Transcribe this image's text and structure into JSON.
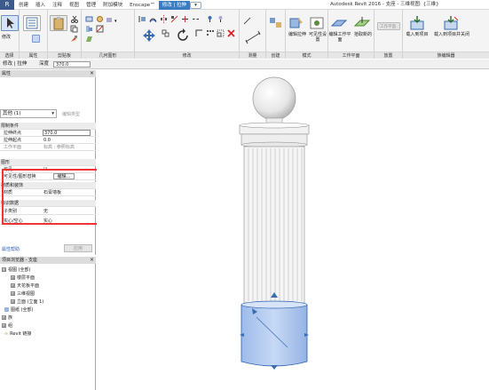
{
  "titlebar": {
    "app_button": "R",
    "tabs": [
      "创建",
      "插入",
      "注释",
      "视图",
      "管理",
      "附加模块",
      "Enscape™",
      "修改 | 拉伸"
    ],
    "title": "Autodesk Revit 2016 -     支座 - 三维视图: {三维}"
  },
  "ribbon": {
    "panels": [
      {
        "label": "选择",
        "buttons": [
          "修改"
        ]
      },
      {
        "label": "属性",
        "buttons": []
      },
      {
        "label": "剪贴板",
        "buttons": []
      },
      {
        "label": "几何图形",
        "buttons": []
      },
      {
        "label": "修改",
        "buttons": []
      },
      {
        "label": "测量",
        "buttons": []
      },
      {
        "label": "创建",
        "buttons": []
      },
      {
        "label": "模式",
        "buttons": [
          "编辑拉伸",
          "可见性设置"
        ]
      },
      {
        "label": "工作平面",
        "buttons": [
          "编辑工作平面",
          "拾取新的"
        ]
      },
      {
        "label": "放置",
        "buttons": [
          "工作平面"
        ]
      },
      {
        "label": "族编辑器",
        "buttons": [
          "载入到项目",
          "载入到项目并关闭"
        ]
      }
    ]
  },
  "options_bar": {
    "context": "修改 | 拉伸",
    "depth_label": "深度",
    "depth_value": "370.0"
  },
  "properties": {
    "header": "属性",
    "type_selector": "其他 (1)",
    "edit_type": "编辑类型",
    "groups": [
      {
        "label": "限制条件",
        "rows": [
          {
            "key": "拉伸终点",
            "value": "370.0"
          },
          {
            "key": "拉伸起点",
            "value": "0.0"
          },
          {
            "key": "工作平面",
            "value": "标高 : 参照标高"
          }
        ]
      },
      {
        "label": "图形",
        "rows": [
          {
            "key": "可见",
            "value": "☑"
          },
          {
            "key": "可见性/图形替换",
            "value": "编辑..."
          }
        ]
      },
      {
        "label": "材质和装饰",
        "rows": [
          {
            "key": "材质",
            "value": "石膏墙板"
          }
        ]
      },
      {
        "label": "标识数据",
        "rows": [
          {
            "key": "子类别",
            "value": "无"
          },
          {
            "key": "实心/空心",
            "value": "实心"
          }
        ]
      }
    ],
    "help": "属性帮助",
    "apply": "应用"
  },
  "browser": {
    "header": "项目浏览器 - 支座",
    "items": [
      {
        "label": "视图 (全部)",
        "level": 0,
        "toggle": "⊟"
      },
      {
        "label": "楼层平面",
        "level": 1,
        "toggle": "⊞"
      },
      {
        "label": "天花板平面",
        "level": 1,
        "toggle": "⊞"
      },
      {
        "label": "三维视图",
        "level": 1,
        "toggle": "⊞"
      },
      {
        "label": "立面 (立面 1)",
        "level": 1,
        "toggle": "⊞"
      },
      {
        "label": "图纸 (全部)",
        "level": 0,
        "toggle": ""
      },
      {
        "label": "族",
        "level": 0,
        "toggle": "⊞"
      },
      {
        "label": "组",
        "level": 0,
        "toggle": "⊞"
      },
      {
        "label": "Revit 链接",
        "level": 0,
        "toggle": ""
      }
    ]
  },
  "colors": {
    "accent": "#3b7cc0",
    "highlight_box": "#e33333",
    "selected_solid": "#b8d0f0"
  }
}
